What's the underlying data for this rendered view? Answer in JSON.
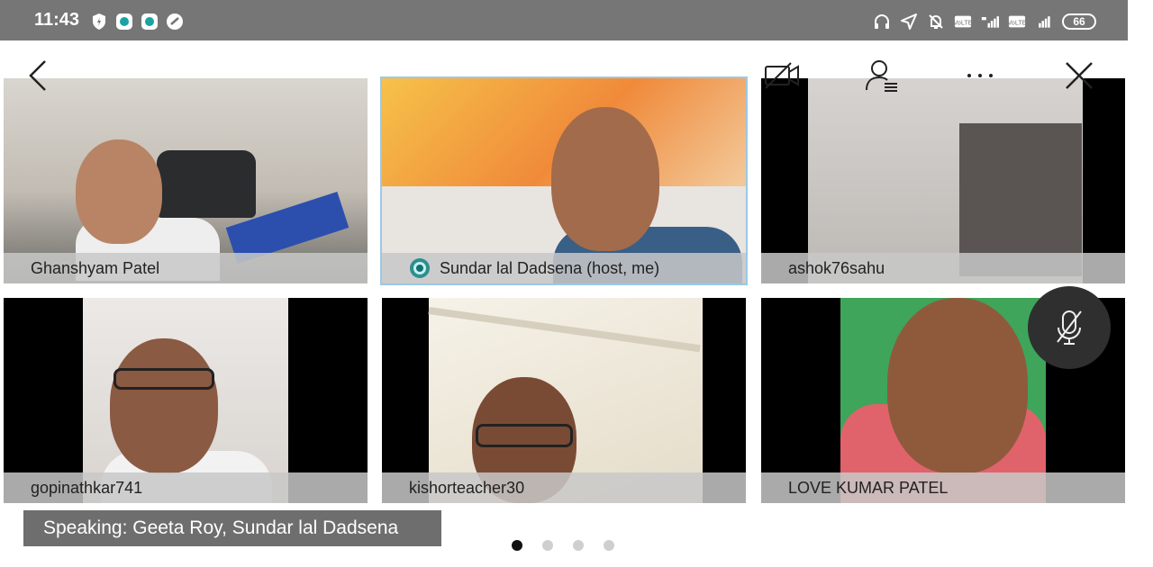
{
  "status_bar": {
    "time": "11:43",
    "battery": "66",
    "left_icons": [
      "shield-icon",
      "app-icon-1",
      "app-icon-2",
      "sync-icon"
    ],
    "right_icons": [
      "headset-icon",
      "location-icon",
      "bell-off-icon",
      "volte-icon",
      "signal-4g-icon",
      "volte-icon",
      "signal-icon"
    ]
  },
  "toolbar": {
    "icons": [
      "back-chevron-icon",
      "video-off-icon",
      "participants-icon",
      "more-icon",
      "close-icon"
    ]
  },
  "participants": [
    {
      "name": "Ghanshyam Patel",
      "host": false
    },
    {
      "name": "Sundar lal Dadsena (host, me)",
      "host": true
    },
    {
      "name": "ashok76sahu",
      "host": false
    },
    {
      "name": "gopinathkar741",
      "host": false
    },
    {
      "name": "kishorteacher30",
      "host": false
    },
    {
      "name": "LOVE KUMAR PATEL",
      "host": false
    }
  ],
  "speaking_banner": "Speaking: Geeta Roy, Sundar lal Dadsena",
  "pagination": {
    "pages": 4,
    "current": 1
  },
  "colors": {
    "status_bar": "#767676",
    "active_tile_border": "#9cc8e6",
    "name_bar": "#c8c8c8"
  }
}
